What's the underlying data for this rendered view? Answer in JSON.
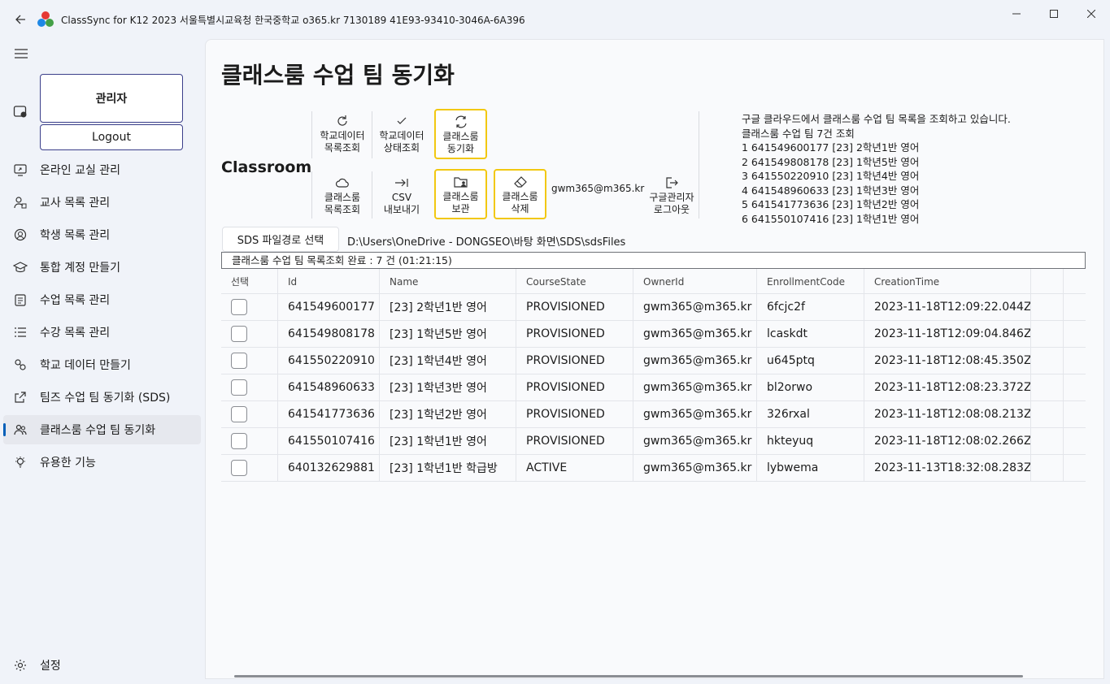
{
  "window": {
    "title": "ClassSync for K12 2023 서울특별시교육청 한국중학교 o365.kr 7130189 41E93-93410-3046A-6A396"
  },
  "sidebar": {
    "admin_label": "관리자",
    "logout_label": "Logout",
    "items": [
      {
        "label": "온라인 교실 관리",
        "icon": "screen-share-icon"
      },
      {
        "label": "교사 목록 관리",
        "icon": "teacher-icon"
      },
      {
        "label": "학생 목록 관리",
        "icon": "student-icon"
      },
      {
        "label": "통합 계정 만들기",
        "icon": "graduation-cap-icon"
      },
      {
        "label": "수업 목록 관리",
        "icon": "clipboard-icon"
      },
      {
        "label": "수강 목록 관리",
        "icon": "list-icon"
      },
      {
        "label": "학교 데이터 만들기",
        "icon": "data-icon"
      },
      {
        "label": "팀즈 수업 팀 동기화 (SDS)",
        "icon": "share-icon"
      },
      {
        "label": "클래스룸 수업 팀 동기화",
        "icon": "people-icon",
        "active": true
      },
      {
        "label": "유용한 기능",
        "icon": "bulb-icon"
      }
    ],
    "settings_label": "설정"
  },
  "main": {
    "title": "클래스룸 수업 팀 동기화",
    "section": "Classroom",
    "toolbar": {
      "school_data_query": "학교데이터\n목록조회",
      "school_data_status": "학교데이터\n상태조회",
      "classroom_sync": "클래스룸\n동기화",
      "classroom_list": "클래스룸\n목록조회",
      "csv_export": "CSV\n내보내기",
      "classroom_archive": "클래스룸\n보관",
      "classroom_delete": "클래스룸\n삭제",
      "email": "gwm365@m365.kr",
      "google_logout": "구글관리자\n로그아웃"
    },
    "log": "구글 클라우드에서 클래스룸 수업 팀 목록을 조회하고 있습니다.\n클래스룸 수업 팀 7건 조회\n1 641549600177 [23] 2학년1반 영어\n2 641549808178 [23] 1학년5반 영어\n3 641550220910 [23] 1학년4반 영어\n4 641548960633 [23] 1학년3반 영어\n5 641541773636 [23] 1학년2반 영어\n6 641550107416 [23] 1학년1반 영어",
    "sds_button": "SDS 파일경로 선택",
    "sds_path": "D:\\Users\\OneDrive - DONGSEO\\바탕 화면\\SDS\\sdsFiles",
    "status": "클래스룸 수업 팀 목록조회 완료  : 7 건 (01:21:15)"
  },
  "table": {
    "headers": [
      "선택",
      "Id",
      "Name",
      "CourseState",
      "OwnerId",
      "EnrollmentCode",
      "CreationTime"
    ],
    "rows": [
      [
        "641549600177",
        "[23] 2학년1반 영어",
        "PROVISIONED",
        "gwm365@m365.kr",
        "6fcjc2f",
        "2023-11-18T12:09:22.044Z"
      ],
      [
        "641549808178",
        "[23] 1학년5반 영어",
        "PROVISIONED",
        "gwm365@m365.kr",
        "lcaskdt",
        "2023-11-18T12:09:04.846Z"
      ],
      [
        "641550220910",
        "[23] 1학년4반 영어",
        "PROVISIONED",
        "gwm365@m365.kr",
        "u645ptq",
        "2023-11-18T12:08:45.350Z"
      ],
      [
        "641548960633",
        "[23] 1학년3반 영어",
        "PROVISIONED",
        "gwm365@m365.kr",
        "bl2orwo",
        "2023-11-18T12:08:23.372Z"
      ],
      [
        "641541773636",
        "[23] 1학년2반 영어",
        "PROVISIONED",
        "gwm365@m365.kr",
        "326rxal",
        "2023-11-18T12:08:08.213Z"
      ],
      [
        "641550107416",
        "[23] 1학년1반 영어",
        "PROVISIONED",
        "gwm365@m365.kr",
        "hkteyuq",
        "2023-11-18T12:08:02.266Z"
      ],
      [
        "640132629881",
        "[23] 1학년1반 학급방",
        "ACTIVE",
        "gwm365@m365.kr",
        "lybwema",
        "2023-11-13T18:32:08.283Z"
      ]
    ]
  },
  "colors": {
    "highlight_border": "#f2c811",
    "active_indicator": "#005fb8",
    "admin_border": "#3b3f8a"
  }
}
